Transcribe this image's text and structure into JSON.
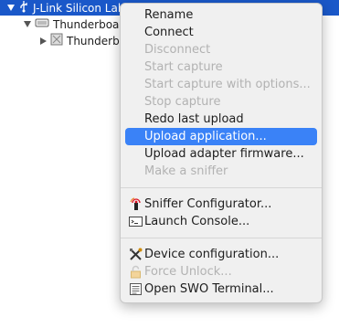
{
  "tree": {
    "root_label": "J-Link Silicon Lab",
    "child_label": "Thunderboard",
    "grandchild_label": "Thunderboa"
  },
  "menu": {
    "groups": [
      [
        {
          "label": "Rename",
          "enabled": true
        },
        {
          "label": "Connect",
          "enabled": true
        },
        {
          "label": "Disconnect",
          "enabled": false
        },
        {
          "label": "Start capture",
          "enabled": false
        },
        {
          "label": "Start capture with options...",
          "enabled": false
        },
        {
          "label": "Stop capture",
          "enabled": false
        },
        {
          "label": "Redo last upload",
          "enabled": true
        },
        {
          "label": "Upload application...",
          "enabled": true,
          "highlighted": true
        },
        {
          "label": "Upload adapter firmware...",
          "enabled": true
        },
        {
          "label": "Make a sniffer",
          "enabled": false
        }
      ],
      [
        {
          "label": "Sniffer Configurator...",
          "enabled": true,
          "icon": "sniffer-icon"
        },
        {
          "label": "Launch Console...",
          "enabled": true,
          "icon": "console-icon"
        }
      ],
      [
        {
          "label": "Device configuration...",
          "enabled": true,
          "icon": "tools-icon"
        },
        {
          "label": "Force Unlock...",
          "enabled": false,
          "icon": "lock-icon"
        },
        {
          "label": "Open SWO Terminal...",
          "enabled": true,
          "icon": "terminal-icon"
        }
      ]
    ]
  },
  "colors": {
    "highlight": "#3a82f7",
    "tree_selection": "#1a58c9",
    "disabled_text": "#b2b2b2"
  }
}
